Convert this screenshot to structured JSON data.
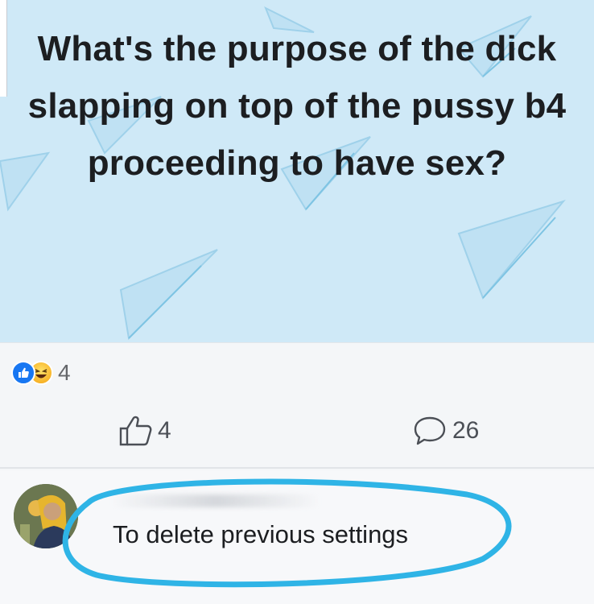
{
  "post": {
    "text": "What's the purpose of the dick slapping on top of the pussy b4 proceeding to have sex?",
    "background_color": "#cfe9f7"
  },
  "reactions": {
    "icons": [
      "like-reaction-icon",
      "haha-reaction-icon"
    ],
    "count": "4"
  },
  "actions": {
    "like_count": "4",
    "comment_count": "26"
  },
  "comment": {
    "text": "To delete previous settings",
    "highlight_color": "#2fb4e6"
  },
  "colors": {
    "facebook_blue": "#1877f2",
    "text": "#1c1e21",
    "muted": "#65676b"
  }
}
